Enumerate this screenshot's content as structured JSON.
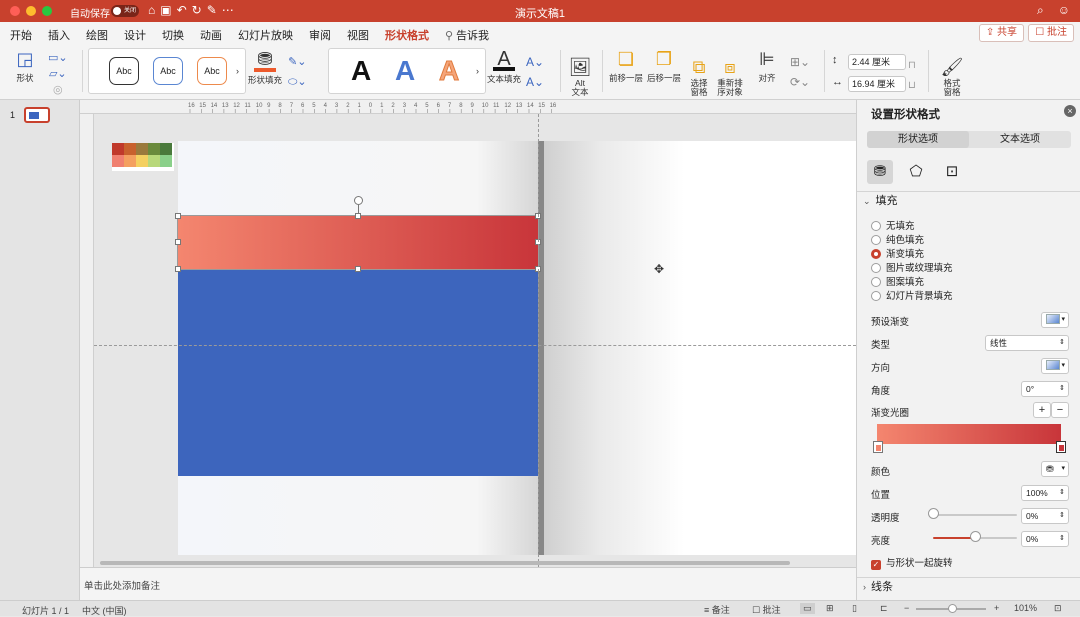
{
  "window": {
    "title": "演示文稿1",
    "autosave_label": "自动保存",
    "autosave_state": "关闭"
  },
  "menu": {
    "tabs": [
      "开始",
      "插入",
      "绘图",
      "设计",
      "切换",
      "动画",
      "幻灯片放映",
      "审阅",
      "视图",
      "形状格式",
      "告诉我"
    ],
    "active_tab": "形状格式",
    "share_label": "共享",
    "comment_label": "批注"
  },
  "ribbon": {
    "shape_label": "形状",
    "style_samples": [
      "Abc",
      "Abc",
      "Abc"
    ],
    "shape_fill_label": "形状填充",
    "wordart_samples": [
      "A",
      "A",
      "A"
    ],
    "text_fill_label": "文本填充",
    "alt_text_label": "Alt\n文本",
    "bring_forward_label": "前移一层",
    "send_backward_label": "后移一层",
    "selection_pane_label": "选择\n窗格",
    "reorder_label": "重新排\n序对象",
    "align_label": "对齐",
    "height_value": "2.44 厘米",
    "width_value": "16.94 厘米",
    "format_pane_label": "格式\n窗格"
  },
  "ruler": {
    "h_ticks": [
      "16",
      "15",
      "14",
      "13",
      "12",
      "11",
      "10",
      "9",
      "8",
      "7",
      "6",
      "5",
      "4",
      "3",
      "2",
      "1",
      "0",
      "1",
      "2",
      "3",
      "4",
      "5",
      "6",
      "7",
      "8",
      "9",
      "10",
      "11",
      "12",
      "13",
      "14",
      "15",
      "16"
    ]
  },
  "slides_panel": {
    "slide_number": "1"
  },
  "notes": {
    "placeholder": "单击此处添加备注"
  },
  "format_pane": {
    "title": "设置形状格式",
    "tabs": [
      "形状选项",
      "文本选项"
    ],
    "fill_section": "填充",
    "fill_options": [
      "无填充",
      "纯色填充",
      "渐变填充",
      "图片或纹理填充",
      "图案填充",
      "幻灯片背景填充"
    ],
    "selected_fill": "渐变填充",
    "preset_gradient_label": "预设渐变",
    "type_label": "类型",
    "type_value": "线性",
    "direction_label": "方向",
    "angle_label": "角度",
    "angle_value": "0°",
    "gradient_stops_label": "渐变光圈",
    "color_label": "颜色",
    "position_label": "位置",
    "position_value": "100%",
    "transparency_label": "透明度",
    "transparency_value": "0%",
    "transparency_level": 0,
    "brightness_label": "亮度",
    "brightness_value": "0%",
    "brightness_level": 0.5,
    "rotate_with_shape_label": "与形状一起旋转",
    "line_section": "线条"
  },
  "status": {
    "slide_info": "幻灯片 1 / 1",
    "language": "中文 (中国)",
    "notes_label": "备注",
    "comments_label": "批注",
    "zoom": "101%"
  },
  "colors": {
    "accent": "#c8412d",
    "red_start": "#f4866f",
    "red_end": "#c8353a",
    "blue": "#3d65bd"
  }
}
